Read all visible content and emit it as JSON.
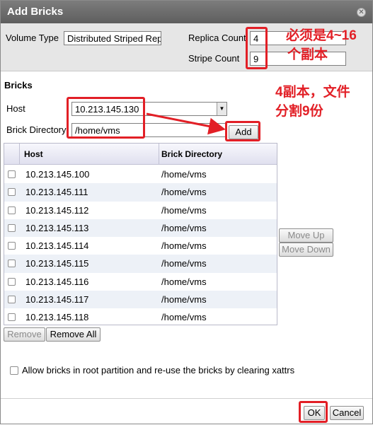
{
  "dialog": {
    "title": "Add Bricks",
    "close_icon": "close-icon"
  },
  "volume": {
    "type_label": "Volume Type",
    "type_value": "Distributed Striped Rep",
    "replica_label": "Replica Count",
    "replica_value": "4",
    "stripe_label": "Stripe Count",
    "stripe_value": "9"
  },
  "bricks": {
    "section_label": "Bricks",
    "host_label": "Host",
    "host_value": "10.213.145.130",
    "dir_label": "Brick Directory",
    "dir_value": "/home/vms",
    "add_label": "Add"
  },
  "table": {
    "headers": [
      "Host",
      "Brick Directory"
    ],
    "rows": [
      {
        "host": "10.213.145.100",
        "dir": "/home/vms"
      },
      {
        "host": "10.213.145.111",
        "dir": "/home/vms"
      },
      {
        "host": "10.213.145.112",
        "dir": "/home/vms"
      },
      {
        "host": "10.213.145.113",
        "dir": "/home/vms"
      },
      {
        "host": "10.213.145.114",
        "dir": "/home/vms"
      },
      {
        "host": "10.213.145.115",
        "dir": "/home/vms"
      },
      {
        "host": "10.213.145.116",
        "dir": "/home/vms"
      },
      {
        "host": "10.213.145.117",
        "dir": "/home/vms"
      },
      {
        "host": "10.213.145.118",
        "dir": "/home/vms"
      }
    ]
  },
  "buttons": {
    "move_up": "Move Up",
    "move_down": "Move Down",
    "remove": "Remove",
    "remove_all": "Remove All",
    "ok": "OK",
    "cancel": "Cancel"
  },
  "options": {
    "root_partition_label": "Allow bricks in root partition and re-use the bricks by clearing xattrs"
  },
  "annotations": {
    "note1_line1": "必须是4~16",
    "note1_line2": "个副本",
    "note2_line1": "4副本，文件",
    "note2_line2": "分割9份",
    "color": "#e21f26"
  }
}
